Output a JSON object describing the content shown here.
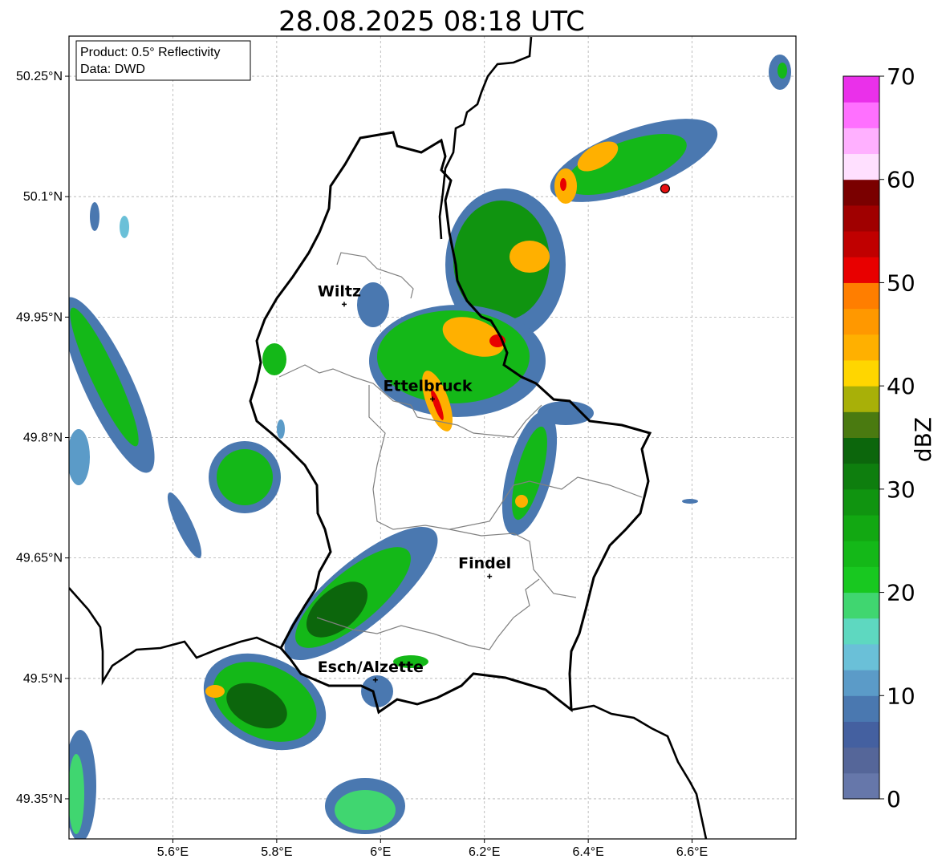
{
  "map": {
    "title": "28.08.2025 08:18 UTC",
    "info": {
      "product": "Product: 0.5° Reflectivity",
      "data": "Data: DWD"
    },
    "lon_range": [
      5.4,
      6.8
    ],
    "lat_range": [
      49.3,
      50.3
    ],
    "lon_ticks": [
      "5.6°E",
      "5.8°E",
      "6°E",
      "6.2°E",
      "6.4°E",
      "6.6°E"
    ],
    "lat_ticks": [
      "49.35°N",
      "49.5°N",
      "49.65°N",
      "49.8°N",
      "49.95°N",
      "50.1°N",
      "50.25°N"
    ],
    "grid": true,
    "cities": [
      {
        "name": "Wiltz",
        "lon": 5.93,
        "lat": 49.966
      },
      {
        "name": "Ettelbruck",
        "lon": 6.1,
        "lat": 49.848
      },
      {
        "name": "Findel",
        "lon": 6.21,
        "lat": 49.627
      },
      {
        "name": "Esch/Alzette",
        "lon": 5.99,
        "lat": 49.498
      }
    ],
    "radar_site": {
      "lon": 6.548,
      "lat": 50.11,
      "color": "#e81010"
    }
  },
  "colorbar": {
    "label": "dBZ",
    "ticks": [
      "0",
      "10",
      "20",
      "30",
      "40",
      "50",
      "60",
      "70"
    ],
    "min": 0,
    "max": 70,
    "step": 2.5,
    "colors": [
      "#6677aa",
      "#556699",
      "#4460a0",
      "#4a78b0",
      "#5b9bc8",
      "#6ac0d8",
      "#5ed8c0",
      "#40d670",
      "#18c820",
      "#14b818",
      "#12a812",
      "#109410",
      "#0e7e0e",
      "#0c660c",
      "#4a7a10",
      "#a8b008",
      "#ffd600",
      "#ffb000",
      "#ff9800",
      "#ff7e00",
      "#e80000",
      "#c00000",
      "#a00000",
      "#7a0000",
      "#ffe0ff",
      "#ffb0ff",
      "#ff70ff",
      "#ea30ea"
    ]
  }
}
